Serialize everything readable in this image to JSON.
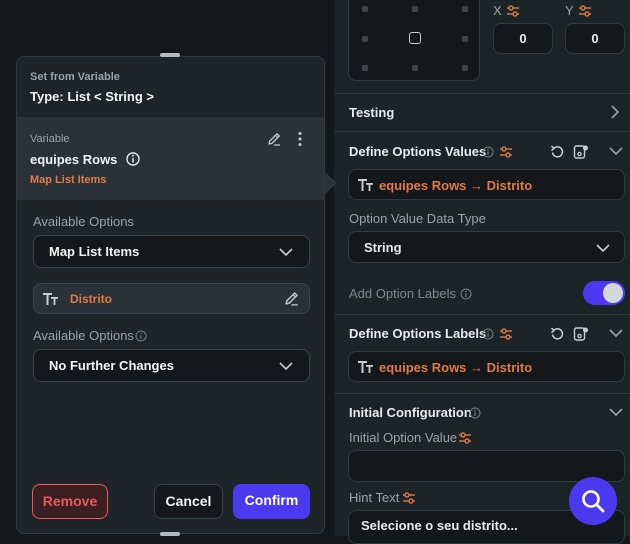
{
  "right_panel": {
    "alignment": {
      "x_label": "X",
      "y_label": "Y",
      "x_value": "0",
      "y_value": "0"
    },
    "testing": {
      "title": "Testing"
    },
    "define_options_values": {
      "title": "Define Options Values",
      "value": "equipes Rows → Distrito"
    },
    "option_value_data_type": {
      "label": "Option Value Data Type",
      "selected": "String"
    },
    "add_option_labels": {
      "label": "Add Option Labels",
      "enabled": true
    },
    "define_options_labels": {
      "title": "Define Options Labels",
      "value": "equipes Rows → Distrito"
    },
    "initial_configuration": {
      "title": "Initial Configuration",
      "initial_option_value_label": "Initial Option Value",
      "initial_option_value": ""
    },
    "hint_text": {
      "label": "Hint Text",
      "value": "Selecione o seu distrito..."
    }
  },
  "dialog": {
    "header_label": "Set from Variable",
    "type_label": "Type: List < String >",
    "variable": {
      "caption": "Variable",
      "name": "equipes Rows",
      "subtitle": "Map List Items"
    },
    "available_options_1": {
      "label": "Available Options",
      "selected": "Map List Items"
    },
    "mapped_field": {
      "value": "Distrito"
    },
    "available_options_2": {
      "label": "Available Options",
      "selected": "No Further Changes"
    },
    "buttons": {
      "remove": "Remove",
      "cancel": "Cancel",
      "confirm": "Confirm"
    }
  },
  "colors": {
    "accent": "#4b39ef",
    "accent_orange": "#e07a47",
    "remove_red": "#e85a5a",
    "panel_bg": "#1d2428",
    "page_bg": "#14181b"
  },
  "icons": [
    "sliders-icon",
    "chevron-right-icon",
    "chevron-down-icon",
    "info-icon",
    "undo-icon",
    "variable-icon",
    "text-type-icon",
    "edit-icon",
    "more-vertical-icon",
    "search-icon"
  ]
}
